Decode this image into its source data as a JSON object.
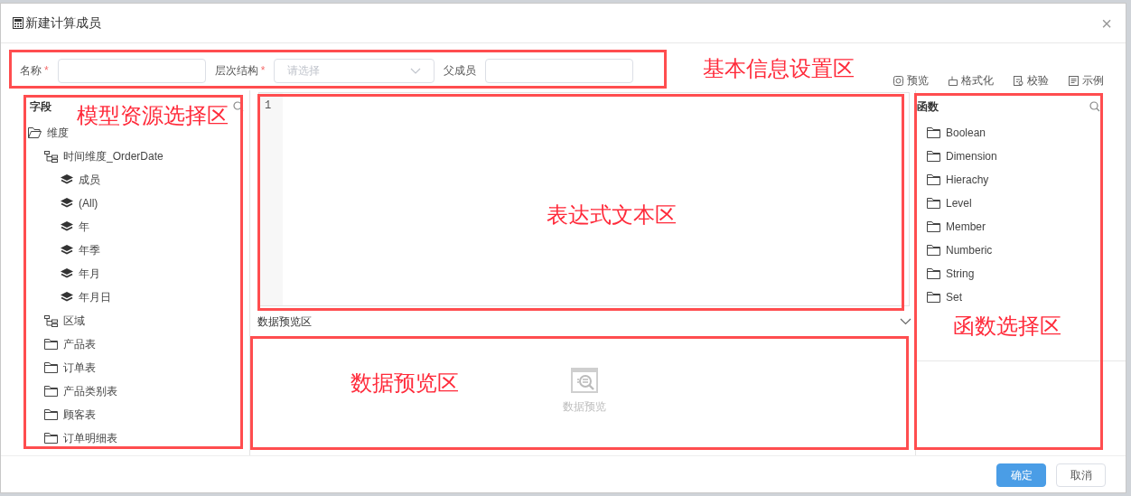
{
  "dialog": {
    "title": "新建计算成员",
    "close": "×"
  },
  "form": {
    "fields": [
      {
        "label": "名称",
        "required_mark": "*",
        "kind": "input"
      },
      {
        "label": "层次结构",
        "required_mark": "*",
        "kind": "select",
        "placeholder": "请选择"
      },
      {
        "label": "父成员",
        "kind": "input"
      }
    ]
  },
  "toolbar": [
    {
      "label": "预览",
      "kind": "preview"
    },
    {
      "label": "格式化",
      "kind": "format"
    },
    {
      "label": "校验",
      "kind": "validate"
    },
    {
      "label": "示例",
      "kind": "example"
    }
  ],
  "fields_panel": {
    "title": "字段",
    "tree": [
      {
        "label": "维度",
        "kind": "folder-open",
        "children": [
          {
            "label": "时间维度_OrderDate",
            "kind": "hierarchy",
            "children": [
              {
                "label": "成员",
                "kind": "level"
              },
              {
                "label": "(All)",
                "kind": "level"
              },
              {
                "label": "年",
                "kind": "level"
              },
              {
                "label": "年季",
                "kind": "level"
              },
              {
                "label": "年月",
                "kind": "level"
              },
              {
                "label": "年月日",
                "kind": "level"
              }
            ]
          },
          {
            "label": "区域",
            "kind": "hierarchy"
          },
          {
            "label": "产品表",
            "kind": "folder"
          },
          {
            "label": "订单表",
            "kind": "folder"
          },
          {
            "label": "产品类别表",
            "kind": "folder"
          },
          {
            "label": "顾客表",
            "kind": "folder"
          },
          {
            "label": "订单明细表",
            "kind": "folder"
          }
        ]
      }
    ]
  },
  "editor": {
    "line_numbers": [
      "1"
    ]
  },
  "preview": {
    "title": "数据预览区",
    "empty_text": "数据预览"
  },
  "functions_panel": {
    "title": "函数",
    "items": [
      "Boolean",
      "Dimension",
      "Hierachy",
      "Level",
      "Member",
      "Numberic",
      "String",
      "Set"
    ]
  },
  "buttons": [
    {
      "label": "确定",
      "kind": "primary"
    },
    {
      "label": "取消",
      "kind": "default"
    }
  ],
  "annotations": [
    {
      "text": "基本信息设置区",
      "kind": "form"
    },
    {
      "text": "模型资源选择区",
      "kind": "fields"
    },
    {
      "text": "表达式文本区",
      "kind": "editor"
    },
    {
      "text": "数据预览区",
      "kind": "preview"
    },
    {
      "text": "函数选择区",
      "kind": "functions"
    }
  ]
}
